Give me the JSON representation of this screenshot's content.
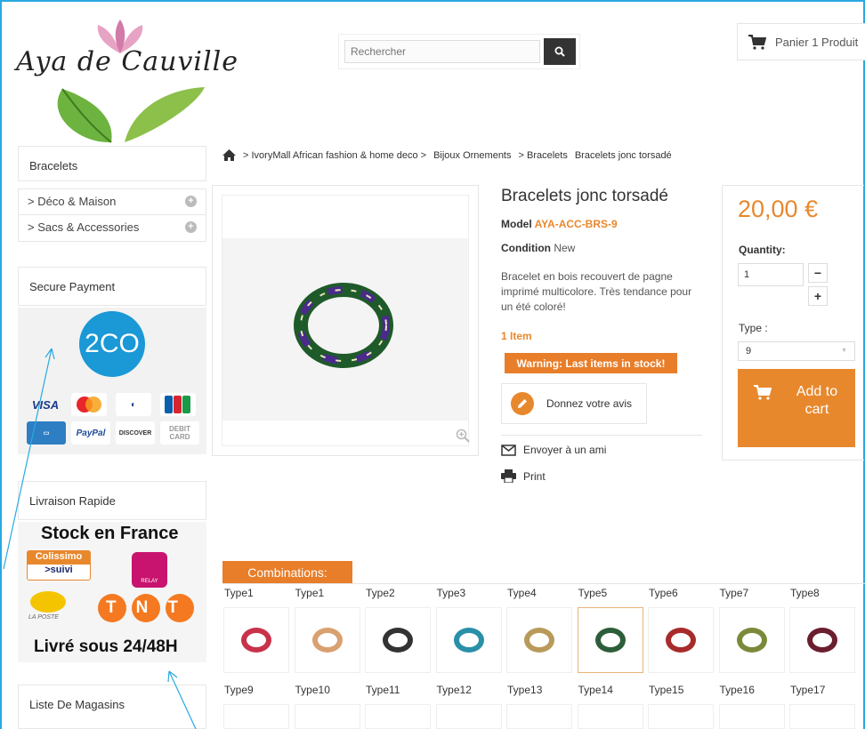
{
  "header": {
    "logo_text": "Aya de Cauville",
    "search_placeholder": "Rechercher",
    "cart_label": "Panier 1 Produit"
  },
  "sidebar": {
    "bracelets_title": "Bracelets",
    "categories": [
      {
        "label": "> Déco & Maison"
      },
      {
        "label": "> Sacs & Accessories"
      }
    ],
    "secure_title": "Secure Payment",
    "twoco_label": "2CO",
    "cards": [
      "VISA",
      "PayPal",
      "DISCOVER",
      "DEBIT CARD"
    ],
    "livraison_title": "Livraison Rapide",
    "ship_headline": "Stock en France",
    "ship_colissimo": "Colissimo",
    "ship_suivi": ">suivi",
    "ship_relay": "RELAY",
    "ship_poste": "LA POSTE",
    "ship_tnt": "TNT",
    "ship_footer": "Livré sous 24/48H",
    "magasins_title": "Liste De Magasins"
  },
  "breadcrumb": {
    "items": [
      "> IvoryMall African fashion & home deco >",
      "Bijoux Ornements",
      "> Bracelets",
      "Bracelets jonc torsadé"
    ]
  },
  "product": {
    "title": "Bracelets jonc torsadé",
    "model_label": "Model",
    "model_ref": "AYA-ACC-BRS-9",
    "condition_label": "Condition",
    "condition_value": "New",
    "description": "Bracelet en bois recouvert de pagne imprimé multicolore. Très tendance pour un été coloré!",
    "items_count": "1 Item",
    "warning": "Warning: Last items in stock!",
    "review_label": "Donnez votre avis",
    "send_friend": "Envoyer à un ami",
    "print": "Print"
  },
  "buy": {
    "price": "20,00 €",
    "quantity_label": "Quantity:",
    "quantity_value": "1",
    "minus": "−",
    "plus": "+",
    "type_label": "Type :",
    "type_value": "9",
    "add_to_cart": "Add to cart"
  },
  "combinations": {
    "tab_label": "Combinations:",
    "row1": [
      {
        "label": "Type1",
        "color": "#c8324a"
      },
      {
        "label": "Type1",
        "color": "#d9a070"
      },
      {
        "label": "Type2",
        "color": "#333333"
      },
      {
        "label": "Type3",
        "color": "#2a8fa8"
      },
      {
        "label": "Type4",
        "color": "#b89a5a"
      },
      {
        "label": "Type5",
        "color": "#2d5e3a"
      },
      {
        "label": "Type6",
        "color": "#a82b2b"
      },
      {
        "label": "Type7",
        "color": "#7a8a3a"
      },
      {
        "label": "Type8",
        "color": "#6a1e2e"
      }
    ],
    "row2": [
      {
        "label": "Type9"
      },
      {
        "label": "Type10"
      },
      {
        "label": "Type11"
      },
      {
        "label": "Type12"
      },
      {
        "label": "Type13"
      },
      {
        "label": "Type14"
      },
      {
        "label": "Type15"
      },
      {
        "label": "Type16"
      },
      {
        "label": "Type17"
      }
    ]
  },
  "colors": {
    "accent": "#e8882d",
    "frame": "#29a9e0"
  }
}
